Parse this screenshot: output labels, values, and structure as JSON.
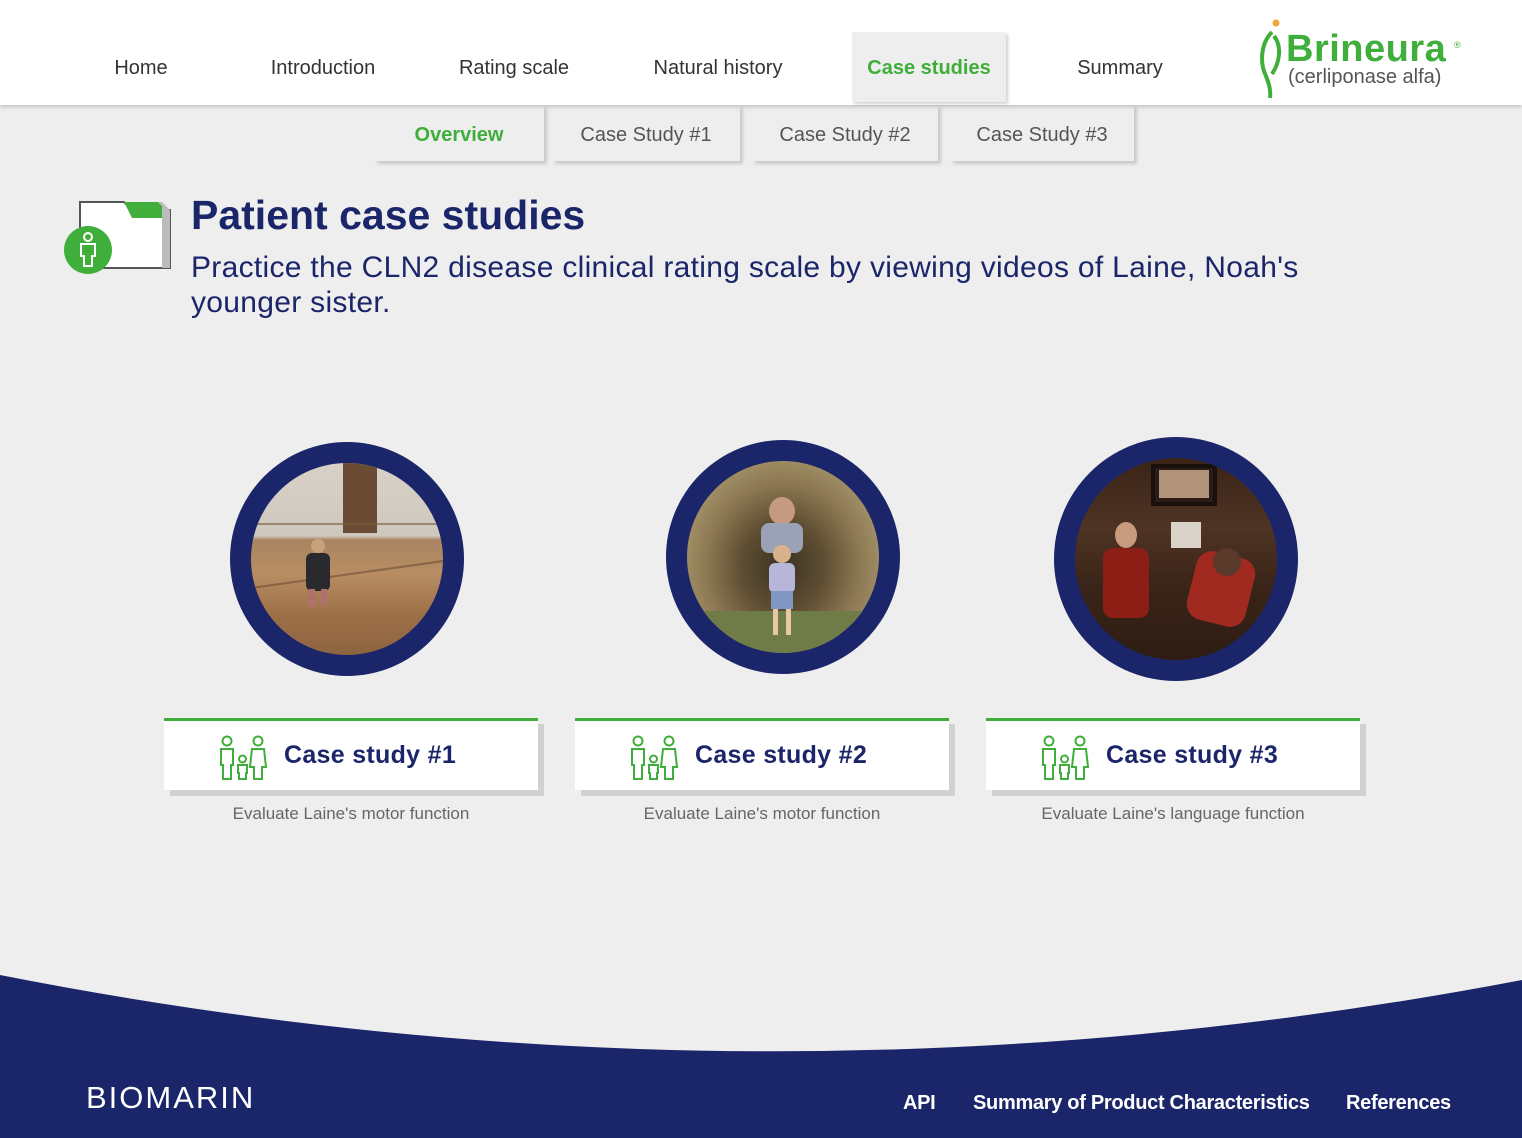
{
  "nav": {
    "items": [
      {
        "label": "Home"
      },
      {
        "label": "Introduction"
      },
      {
        "label": "Rating scale"
      },
      {
        "label": "Natural history"
      },
      {
        "label": "Case studies"
      },
      {
        "label": "Summary"
      }
    ],
    "active": "Case studies"
  },
  "logo": {
    "brand": "Brineura",
    "reg": "®",
    "generic": "(cerliponase alfa)"
  },
  "subnav": {
    "items": [
      {
        "label": "Overview"
      },
      {
        "label": "Case Study #1"
      },
      {
        "label": "Case Study #2"
      },
      {
        "label": "Case Study #3"
      }
    ],
    "active": "Overview"
  },
  "header": {
    "title": "Patient case studies",
    "subtitle": "Practice the CLN2 disease clinical rating scale by viewing videos of Laine, Noah's younger sister."
  },
  "cases": [
    {
      "label": "Case study #1",
      "description": "Evaluate Laine's motor function"
    },
    {
      "label": "Case study #2",
      "description": "Evaluate Laine's motor function"
    },
    {
      "label": "Case study #3",
      "description": "Evaluate Laine's language function"
    }
  ],
  "footer": {
    "company": "BIOMARIN",
    "links": [
      {
        "label": "API"
      },
      {
        "label": "Summary of Product Characteristics"
      },
      {
        "label": "References"
      }
    ]
  },
  "colors": {
    "navy": "#1b2569",
    "green": "#3fae3a",
    "background": "#eeeeee"
  }
}
